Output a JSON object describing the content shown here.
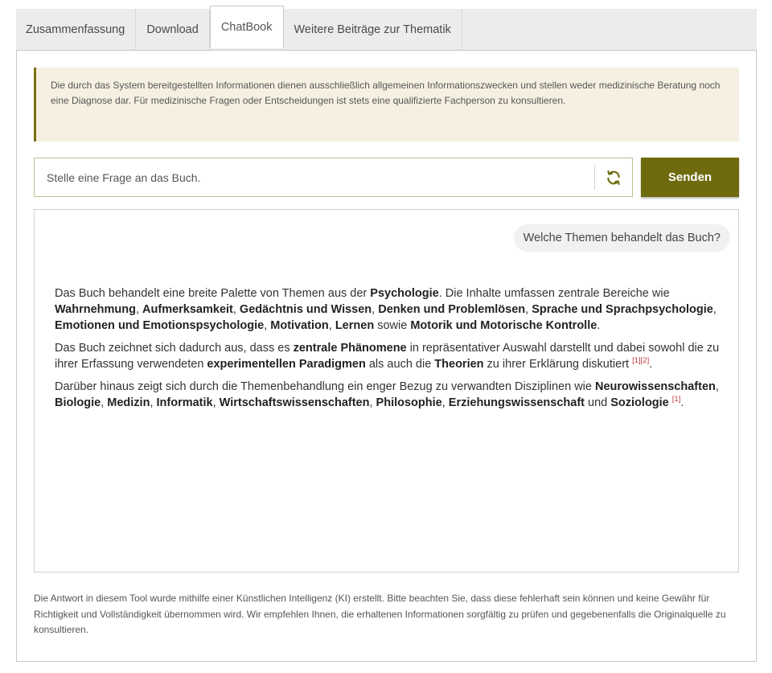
{
  "tabs": [
    {
      "label": "Zusammenfassung"
    },
    {
      "label": "Download"
    },
    {
      "label": "ChatBook"
    },
    {
      "label": "Weitere Beiträge zur Thematik"
    }
  ],
  "notice": {
    "text": "Die durch das System bereitgestellten Informationen dienen ausschließlich allgemeinen Informationszwecken und stellen weder medizinische Beratung noch eine Diagnose dar. Für medizinische Fragen oder Entscheidungen ist stets eine qualifizierte Fachperson zu konsultieren."
  },
  "ask": {
    "placeholder": "Stelle eine Frage an das Buch.",
    "value": "",
    "send_label": "Senden"
  },
  "chat": {
    "question": "Welche Themen behandelt das Buch?",
    "p1": {
      "t1": "Das Buch behandelt eine breite Palette von Themen aus der ",
      "b1": "Psychologie",
      "t2": ". Die Inhalte umfassen zentrale Bereiche wie ",
      "b2": "Wahrnehmung",
      "t3": ", ",
      "b3": "Aufmerksamkeit",
      "t4": ", ",
      "b4": "Gedächtnis und Wissen",
      "t5": ", ",
      "b5": "Denken und Problemlösen",
      "t6": ", ",
      "b6": "Sprache und Sprachpsychologie",
      "t7": ", ",
      "b7": "Emotionen und Emotionspsychologie",
      "t8": ", ",
      "b8": "Motivation",
      "t9": ", ",
      "b9": "Lernen",
      "t10": " sowie ",
      "b10": "Motorik und Motorische Kontrolle",
      "t11": "."
    },
    "p2": {
      "t1": "Das Buch zeichnet sich dadurch aus, dass es ",
      "b1": "zentrale Phänomene",
      "t2": " in repräsentativer Auswahl darstellt und dabei sowohl die zu ihrer Erfassung verwendeten ",
      "b2": "experimentellen Paradigmen",
      "t3": " als auch die ",
      "b3": "Theorien",
      "t4": " zu ihrer Erklärung diskutiert ",
      "ref1": "[1]",
      "ref2": "[2]",
      "t5": "."
    },
    "p3": {
      "t1": "Darüber hinaus zeigt sich durch die Themenbehandlung ein enger Bezug zu verwandten Disziplinen wie ",
      "b1": "Neurowissenschaften",
      "t2": ", ",
      "b2": "Biologie",
      "t3": ", ",
      "b3": "Medizin",
      "t4": ", ",
      "b4": "Informatik",
      "t5": ", ",
      "b5": "Wirtschaftswissenschaften",
      "t6": ", ",
      "b6": "Philosophie",
      "t7": ", ",
      "b7": "Erziehungswissenschaft",
      "t8": " und ",
      "b8": "Soziologie",
      "t9": " ",
      "ref1": "[1]",
      "t10": "."
    }
  },
  "disclaimer": {
    "text": "Die Antwort in diesem Tool wurde mithilfe einer Künstlichen Intelligenz (KI) erstellt. Bitte beachten Sie, dass diese fehlerhaft sein können und keine Gewähr für Richtigkeit und Vollständigkeit übernommen wird. Wir empfehlen Ihnen, die erhaltenen Informationen sorgfältig zu prüfen und gegebenenfalls die Originalquelle zu konsultieren."
  },
  "icons": {
    "refresh": "refresh-icon"
  },
  "colors": {
    "accent": "#6e6b0f",
    "notice_bg": "#f6f0e2",
    "notice_border": "#7a7210",
    "ref": "#c63b3b"
  }
}
